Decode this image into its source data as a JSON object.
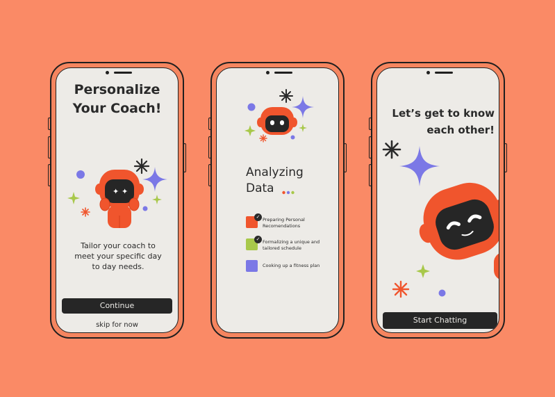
{
  "colors": {
    "background": "#FA8A66",
    "screen": "#EDEBE7",
    "accent_red": "#F0552D",
    "lime": "#A8C84A",
    "purple": "#7B78E6",
    "dark": "#262626"
  },
  "screen1": {
    "title_line1": "Personalize",
    "title_line2": "Your Coach!",
    "description": "Tailor your coach to meet your specific day to day needs.",
    "continue_label": "Continue",
    "skip_label": "skip for now"
  },
  "screen2": {
    "heading_line1": "Analyzing",
    "heading_line2": "Data",
    "tasks": [
      {
        "label": "Preparing Personal Recomendations",
        "color": "#F0552D",
        "checked": true
      },
      {
        "label": "Formalizing a unique and tailored schedule",
        "color": "#A8C84A",
        "checked": true
      },
      {
        "label": "Cooking up a fitness plan",
        "color": "#7B78E6",
        "checked": false
      }
    ]
  },
  "screen3": {
    "title_line1": "Let’s get to know",
    "title_line2": "each other!",
    "start_label": "Start Chatting"
  },
  "icons": [
    "asterisk-icon",
    "sparkle-icon",
    "robot-mascot-icon",
    "checkmark-icon",
    "loading-dots-icon"
  ]
}
